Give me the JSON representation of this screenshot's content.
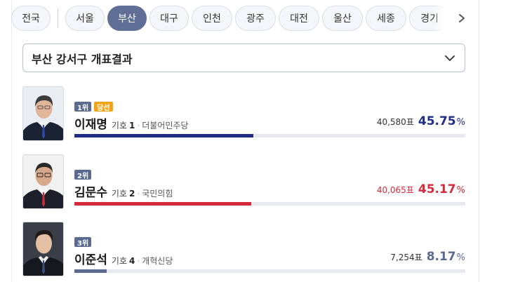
{
  "regions": {
    "items": [
      "전국",
      "서울",
      "부산",
      "대구",
      "인천",
      "광주",
      "대전",
      "울산",
      "세종",
      "경기"
    ],
    "selected": "부산"
  },
  "dropdown": {
    "label": "부산 강서구 개표결과"
  },
  "candidates": [
    {
      "rank": "1위",
      "winner_label": "당선",
      "name": "이재명",
      "kiho_label": "기호",
      "kiho_number": "1",
      "party": "더불어민주당",
      "votes": "40,580표",
      "percent": "45.75",
      "percent_sign": "%",
      "share": 45.75,
      "color": "#1f2d86"
    },
    {
      "rank": "2위",
      "winner_label": "",
      "name": "김문수",
      "kiho_label": "기호",
      "kiho_number": "2",
      "party": "국민의힘",
      "votes": "40,065표",
      "percent": "45.17",
      "percent_sign": "%",
      "share": 45.17,
      "color": "#d6293a"
    },
    {
      "rank": "3위",
      "winner_label": "",
      "name": "이준석",
      "kiho_label": "기호",
      "kiho_number": "4",
      "party": "개혁신당",
      "votes": "7,254표",
      "percent": "8.17",
      "percent_sign": "%",
      "share": 8.17,
      "color": "#5b6b8f"
    }
  ],
  "colors": {
    "chip_active": "#5f6f96",
    "winner_badge": "#f2a316",
    "rank_badge": "#5b6b8f"
  }
}
